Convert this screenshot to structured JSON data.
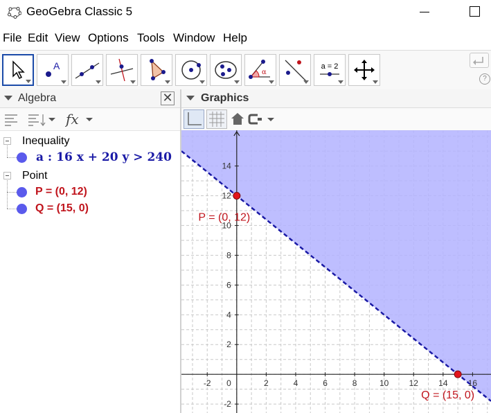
{
  "window": {
    "title": "GeoGebra Classic 5"
  },
  "menu": [
    "File",
    "Edit",
    "View",
    "Options",
    "Tools",
    "Window",
    "Help"
  ],
  "toolbar": {
    "tools": [
      "move-tool",
      "point-tool",
      "line-tool",
      "perpendicular-line-tool",
      "polygon-tool",
      "circle-tool",
      "conic-tool",
      "angle-tool",
      "reflect-tool",
      "slider-tool",
      "move-graphics-view-tool"
    ],
    "slider_label": "a = 2",
    "help": "?"
  },
  "algebra": {
    "title": "Algebra",
    "close": "✕",
    "groups": [
      {
        "label": "Inequality",
        "items": [
          {
            "text": "a : 16 x + 20 y > 240",
            "color": "#1a1aa6"
          }
        ]
      },
      {
        "label": "Point",
        "items": [
          {
            "text": "P = (0, 12)",
            "color": "#c0141c"
          },
          {
            "text": "Q = (15, 0)",
            "color": "#c0141c"
          }
        ]
      }
    ]
  },
  "graphics": {
    "title": "Graphics",
    "x_ticks": [
      -2,
      2,
      4,
      6,
      8,
      10,
      12,
      14,
      16
    ],
    "y_ticks": [
      -2,
      2,
      4,
      6,
      8,
      10,
      12,
      14
    ],
    "origin_label": "0",
    "x_range": [
      -3.75,
      17.25
    ],
    "y_range": [
      -2.6,
      16.4
    ],
    "inequality": {
      "a": 16,
      "b": 20,
      "c": 240,
      "op": ">"
    },
    "points": [
      {
        "name": "P",
        "x": 0,
        "y": 12,
        "label": "P = (0, 12)"
      },
      {
        "name": "Q",
        "x": 15,
        "y": 0,
        "label": "Q = (15, 0)"
      }
    ],
    "colors": {
      "region": "#b3b3ff",
      "boundary": "#1a1aa6",
      "point": "#e3141c",
      "grid": "#c8c8c8"
    }
  }
}
